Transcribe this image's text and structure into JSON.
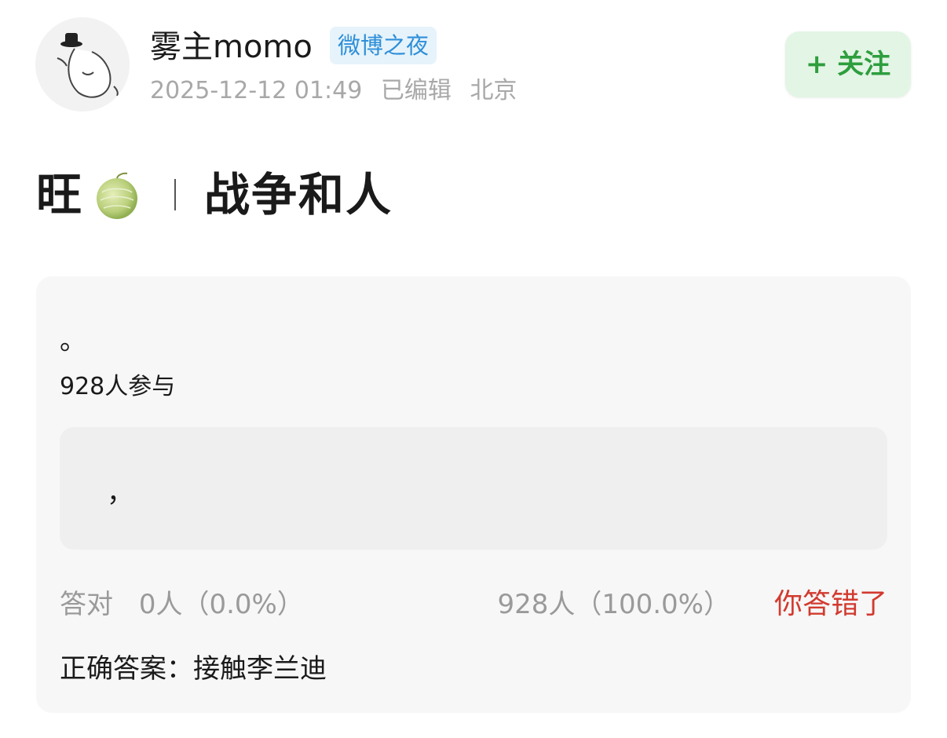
{
  "post": {
    "author": "雾主momo",
    "badge": "微博之夜",
    "timestamp": "2025-12-12 01:49",
    "edited": "已编辑",
    "location": "北京",
    "follow_label": "+ 关注"
  },
  "title": {
    "left": "旺",
    "icon": "melon-icon",
    "right": "战争和人"
  },
  "quiz": {
    "question": "。",
    "participants": "928人参与",
    "option_text": "，",
    "correct_label": "答对",
    "correct_count": "0人（0.0%）",
    "wrong_stat": "928人（100.0%）",
    "result": "你答错了",
    "answer_label": "正确答案：",
    "answer_text": "接触李兰迪"
  },
  "colors": {
    "follow_green": "#2e9e3e",
    "badge_blue": "#2f8fd8",
    "wrong_red": "#d23a2f"
  }
}
